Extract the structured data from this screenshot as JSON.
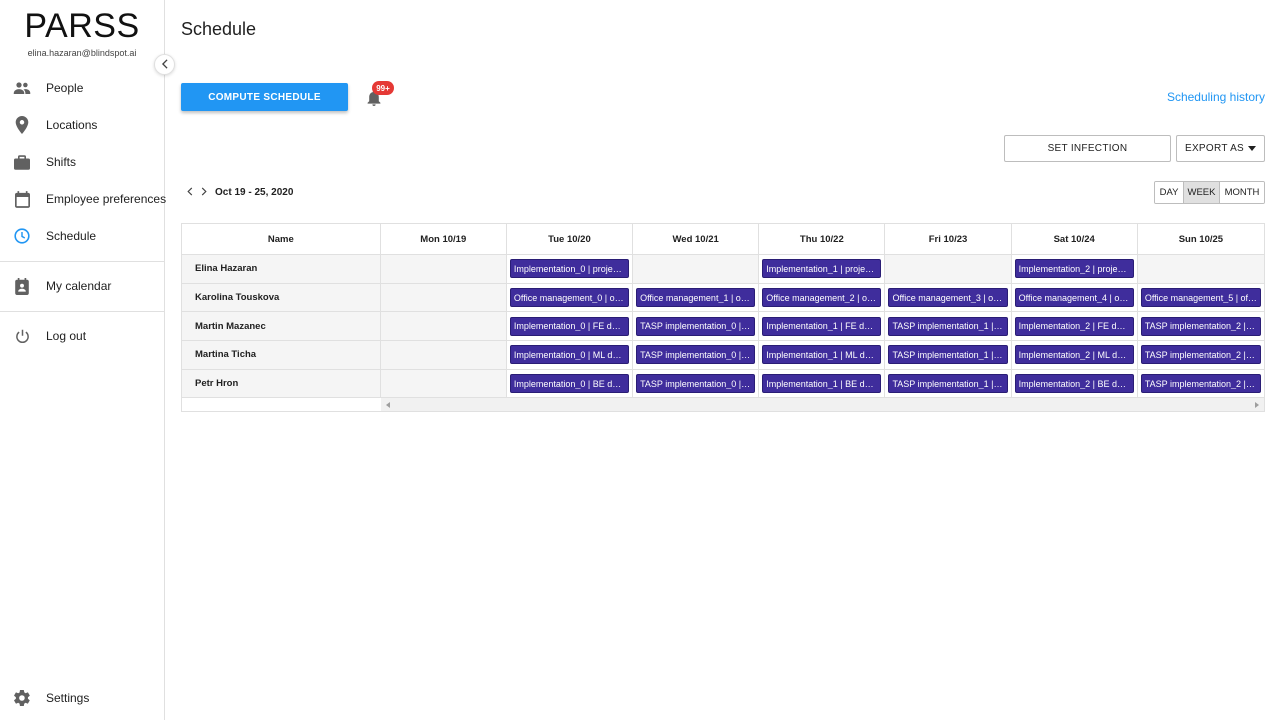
{
  "brand": {
    "title": "PARSS",
    "email": "elina.hazaran@blindspot.ai"
  },
  "nav": {
    "people": "People",
    "locations": "Locations",
    "shifts": "Shifts",
    "employee_preferences": "Employee preferences",
    "schedule": "Schedule",
    "my_calendar": "My calendar",
    "log_out": "Log out",
    "settings": "Settings"
  },
  "colors": {
    "accent": "#2196f3",
    "event": "#3f2d9c",
    "badge": "#e53935"
  },
  "page": {
    "title": "Schedule",
    "compute_label": "COMPUTE SCHEDULE",
    "badge_count": "99+",
    "history_link": "Scheduling history",
    "set_infection_label": "SET INFECTION",
    "export_label": "EXPORT AS",
    "date_range": "Oct 19 - 25, 2020",
    "views": {
      "day": "DAY",
      "week": "WEEK",
      "month": "MONTH",
      "active": "WEEK"
    }
  },
  "table": {
    "headers": {
      "name": "Name",
      "mon": "Mon 10/19",
      "tue": "Tue 10/20",
      "wed": "Wed 10/21",
      "thu": "Thu 10/22",
      "fri": "Fri 10/23",
      "sat": "Sat 10/24",
      "sun": "Sun 10/25"
    },
    "rows": [
      {
        "name": "Elina Hazaran",
        "mon": "",
        "tue": "Implementation_0 | project ...",
        "wed": "",
        "thu": "Implementation_1 | project ...",
        "fri": "",
        "sat": "Implementation_2 | project ...",
        "sun": ""
      },
      {
        "name": "Karolina Touskova",
        "mon": "",
        "tue": "Office management_0 | offi...",
        "wed": "Office management_1 | offi...",
        "thu": "Office management_2 | offi...",
        "fri": "Office management_3 | offi...",
        "sat": "Office management_4 | offi...",
        "sun": "Office management_5 | offi..."
      },
      {
        "name": "Martin Mazanec",
        "mon": "",
        "tue": "Implementation_0 | FE deve...",
        "wed": "TASP implementation_0 | F...",
        "thu": "Implementation_1 | FE deve...",
        "fri": "TASP implementation_1 | F...",
        "sat": "Implementation_2 | FE deve...",
        "sun": "TASP implementation_2 | F..."
      },
      {
        "name": "Martina Ticha",
        "mon": "",
        "tue": "Implementation_0 | ML dev...",
        "wed": "TASP implementation_0 | M...",
        "thu": "Implementation_1 | ML dev...",
        "fri": "TASP implementation_1 | M...",
        "sat": "Implementation_2 | ML dev...",
        "sun": "TASP implementation_2 | B..."
      },
      {
        "name": "Petr Hron",
        "mon": "",
        "tue": "Implementation_0 | BE deve...",
        "wed": "TASP implementation_0 | B...",
        "thu": "Implementation_1 | BE deve...",
        "fri": "TASP implementation_1 | B...",
        "sat": "Implementation_2 | BE deve...",
        "sun": "TASP implementation_2 | M..."
      }
    ]
  }
}
